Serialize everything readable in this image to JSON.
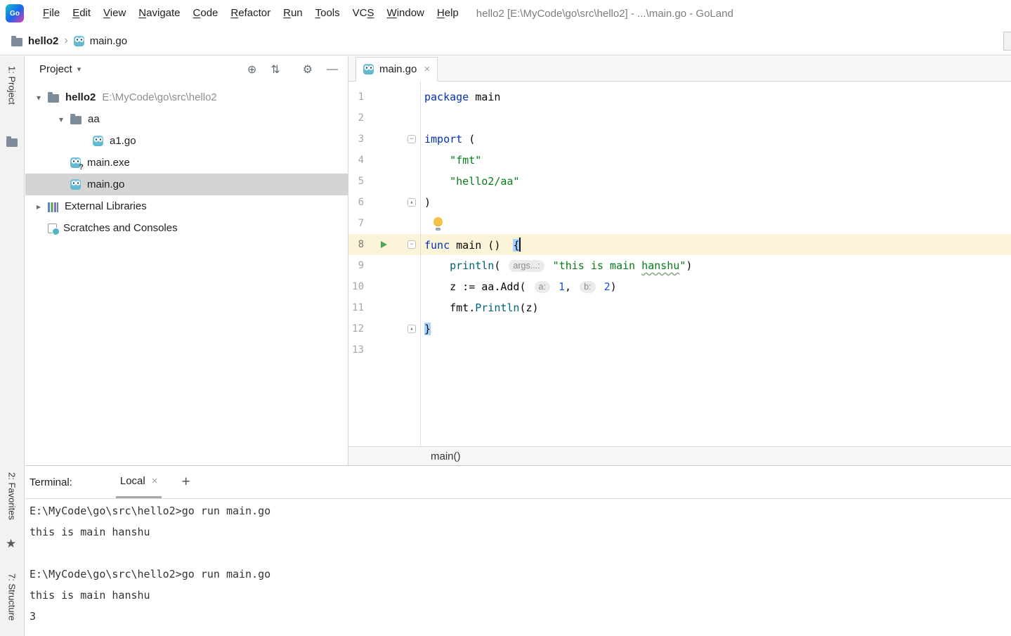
{
  "window": {
    "title": "hello2 [E:\\MyCode\\go\\src\\hello2] - ...\\main.go - GoLand"
  },
  "icons": {
    "logo_text": "Go",
    "locate": "⊕",
    "collapse": "⇅",
    "settings": "⚙",
    "hide": "—",
    "close": "×",
    "add": "+",
    "chevron_down": "▾",
    "chevron_right": "▸",
    "separator": "›",
    "star": "★",
    "dropdown_caret": "▾",
    "fold_start": "−",
    "fold_end": "▴"
  },
  "menu": {
    "items": [
      {
        "label": "File",
        "mnemonic": 0
      },
      {
        "label": "Edit",
        "mnemonic": 0
      },
      {
        "label": "View",
        "mnemonic": 0
      },
      {
        "label": "Navigate",
        "mnemonic": 0
      },
      {
        "label": "Code",
        "mnemonic": 0
      },
      {
        "label": "Refactor",
        "mnemonic": 0
      },
      {
        "label": "Run",
        "mnemonic": 0
      },
      {
        "label": "Tools",
        "mnemonic": 0
      },
      {
        "label": "VCS",
        "mnemonic": 2
      },
      {
        "label": "Window",
        "mnemonic": 0
      },
      {
        "label": "Help",
        "mnemonic": 0
      }
    ]
  },
  "breadcrumb": {
    "items": [
      {
        "label": "hello2",
        "icon": "folder",
        "bold": true
      },
      {
        "label": "main.go",
        "icon": "go-file",
        "bold": false
      }
    ]
  },
  "tool_stripe": {
    "project": "1: Project",
    "favorites": "2: Favorites",
    "structure": "7: Structure"
  },
  "project_panel": {
    "title": "Project",
    "tree": [
      {
        "label": "hello2",
        "suffix": "E:\\MyCode\\go\\src\\hello2",
        "icon": "folder",
        "chevron": "down",
        "indent": 0,
        "bold": true
      },
      {
        "label": "aa",
        "icon": "folder",
        "chevron": "down",
        "indent": 1
      },
      {
        "label": "a1.go",
        "icon": "go-file",
        "indent": 2
      },
      {
        "label": "main.exe",
        "icon": "exe-file",
        "indent": 1
      },
      {
        "label": "main.go",
        "icon": "go-file",
        "indent": 1,
        "selected": true
      },
      {
        "label": "External Libraries",
        "icon": "libraries",
        "chevron": "right",
        "indent": 0
      },
      {
        "label": "Scratches and Consoles",
        "icon": "scratches",
        "indent": 0
      }
    ]
  },
  "editor": {
    "tab": {
      "label": "main.go"
    },
    "breadcrumb": "main()",
    "lines": [
      {
        "num": "1",
        "tokens": [
          {
            "t": "package",
            "c": "kw"
          },
          {
            "t": " main",
            "c": "pl"
          }
        ]
      },
      {
        "num": "2",
        "tokens": []
      },
      {
        "num": "3",
        "fold": "start",
        "tokens": [
          {
            "t": "import",
            "c": "kw"
          },
          {
            "t": " (",
            "c": "pl"
          }
        ]
      },
      {
        "num": "4",
        "tokens": [
          {
            "t": "    ",
            "c": "pl"
          },
          {
            "t": "\"fmt\"",
            "c": "str"
          }
        ]
      },
      {
        "num": "5",
        "tokens": [
          {
            "t": "    ",
            "c": "pl"
          },
          {
            "t": "\"hello2/aa\"",
            "c": "str"
          }
        ]
      },
      {
        "num": "6",
        "fold": "end",
        "tokens": [
          {
            "t": ")",
            "c": "pl"
          }
        ]
      },
      {
        "num": "7",
        "bulb": true,
        "tokens": []
      },
      {
        "num": "8",
        "fold": "start",
        "run": true,
        "current": true,
        "caret": true,
        "tokens": [
          {
            "t": "func",
            "c": "kw"
          },
          {
            "t": " main ()  ",
            "c": "pl"
          },
          {
            "t": "{",
            "c": "pl brace"
          }
        ]
      },
      {
        "num": "9",
        "tokens": [
          {
            "t": "    ",
            "c": "pl"
          },
          {
            "t": "println",
            "c": "fn"
          },
          {
            "t": "( ",
            "c": "pl"
          },
          {
            "t": "args...:",
            "c": "hint"
          },
          {
            "t": " ",
            "c": "pl"
          },
          {
            "t": "\"this is main ",
            "c": "str"
          },
          {
            "t": "hanshu",
            "c": "str squiggle"
          },
          {
            "t": "\"",
            "c": "str"
          },
          {
            "t": ")",
            "c": "pl"
          }
        ]
      },
      {
        "num": "10",
        "tokens": [
          {
            "t": "    z := aa.Add",
            "c": "pl"
          },
          {
            "t": "( ",
            "c": "pl"
          },
          {
            "t": "a:",
            "c": "hint"
          },
          {
            "t": " ",
            "c": "pl"
          },
          {
            "t": "1",
            "c": "num"
          },
          {
            "t": ", ",
            "c": "pl"
          },
          {
            "t": "b:",
            "c": "hint"
          },
          {
            "t": " ",
            "c": "pl"
          },
          {
            "t": "2",
            "c": "num"
          },
          {
            "t": ")",
            "c": "pl"
          }
        ]
      },
      {
        "num": "11",
        "tokens": [
          {
            "t": "    fmt.",
            "c": "pl"
          },
          {
            "t": "Println",
            "c": "fn"
          },
          {
            "t": "(z)",
            "c": "pl"
          }
        ]
      },
      {
        "num": "12",
        "fold": "end",
        "tokens": [
          {
            "t": "}",
            "c": "pl brace"
          }
        ]
      },
      {
        "num": "13",
        "tokens": []
      }
    ]
  },
  "terminal": {
    "title": "Terminal:",
    "tab": "Local",
    "lines": [
      "E:\\MyCode\\go\\src\\hello2>go run main.go",
      "this is main hanshu",
      "",
      "E:\\MyCode\\go\\src\\hello2>go run main.go",
      "this is main hanshu",
      "3"
    ]
  },
  "colors": {
    "keyword": "#0033B3",
    "string": "#067D17",
    "number": "#1750EB",
    "function_call": "#00627A",
    "brace_match_bg": "#A6D2FF",
    "current_line_bg": "#FBF4D8",
    "selected_row_bg": "#D4D4D4",
    "run_icon_green": "#4FA356",
    "bulb_yellow": "#F6C445"
  }
}
